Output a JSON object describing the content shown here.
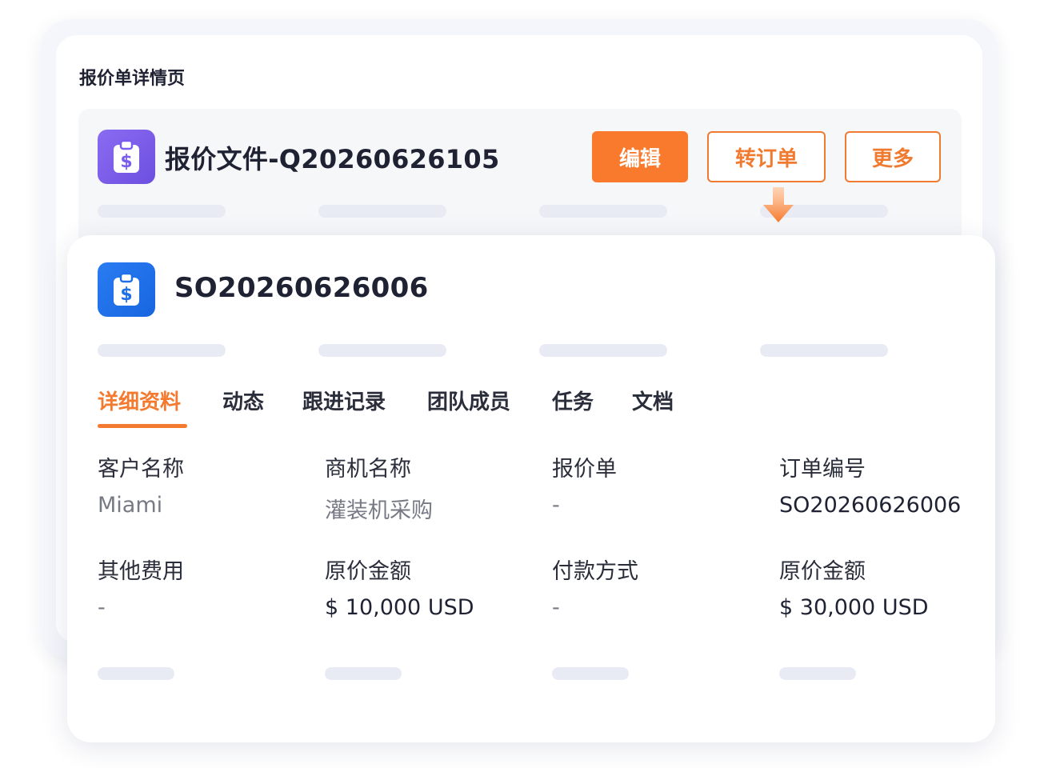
{
  "page": {
    "heading": "报价单详情页"
  },
  "quote": {
    "title": "报价文件-Q20260626105",
    "icon": "clipboard-dollar-icon",
    "icon_color": "#7a5cf0",
    "actions": {
      "edit": "编辑",
      "convert": "转订单",
      "more": "更多"
    }
  },
  "order": {
    "number": "SO20260626006",
    "icon": "clipboard-dollar-icon",
    "icon_color": "#1f6fe8",
    "tabs": [
      {
        "label": "详细资料",
        "active": true
      },
      {
        "label": "动态",
        "active": false
      },
      {
        "label": "跟进记录",
        "active": false
      },
      {
        "label": "团队成员",
        "active": false
      },
      {
        "label": "任务",
        "active": false
      },
      {
        "label": "文档",
        "active": false
      }
    ],
    "fields": [
      {
        "label": "客户名称",
        "value": "Miami"
      },
      {
        "label": "商机名称",
        "value": "灌装机采购"
      },
      {
        "label": "报价单",
        "value": "-"
      },
      {
        "label": "订单编号",
        "value": "SO20260626006"
      },
      {
        "label": "其他费用",
        "value": "-"
      },
      {
        "label": "原价金额",
        "value": "$ 10,000 USD"
      },
      {
        "label": "付款方式",
        "value": "-"
      },
      {
        "label": "原价金额",
        "value": "$ 30,000 USD"
      }
    ]
  },
  "colors": {
    "accent": "#f97a2c",
    "skeleton": "#e8ebf3"
  }
}
